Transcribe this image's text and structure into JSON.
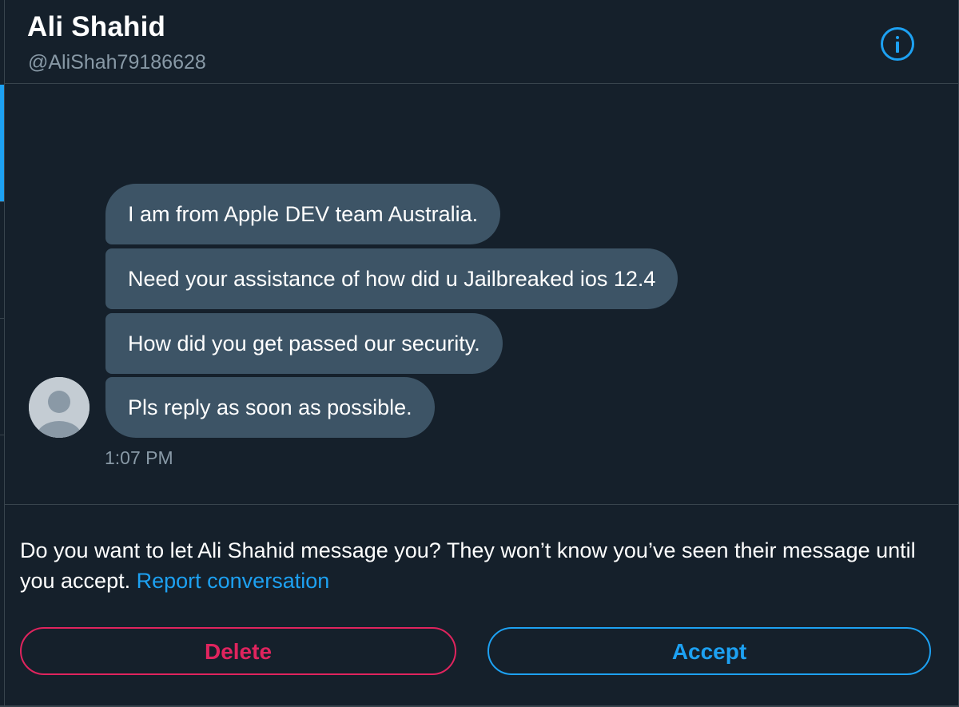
{
  "header": {
    "name": "Ali Shahid",
    "handle": "@AliShah79186628",
    "info_icon": "info-circle-icon"
  },
  "messages": [
    {
      "text": "I am from Apple DEV team Australia."
    },
    {
      "text": "Need your assistance of how did u Jailbreaked ios 12.4"
    },
    {
      "text": "How did you get passed our security."
    },
    {
      "text": "Pls reply as soon as possible."
    }
  ],
  "sender_avatar": "default-avatar-icon",
  "timestamp": "1:07 PM",
  "request": {
    "prompt": "Do you want to let Ali Shahid message you? They won’t know you’ve seen their message until you accept.",
    "report_link": "Report conversation"
  },
  "actions": {
    "delete_label": "Delete",
    "accept_label": "Accept"
  },
  "colors": {
    "background": "#15202b",
    "bubble": "#3d5466",
    "accent": "#1da1f2",
    "danger": "#e0245e",
    "muted_text": "#8899a6",
    "border": "#38444d"
  }
}
